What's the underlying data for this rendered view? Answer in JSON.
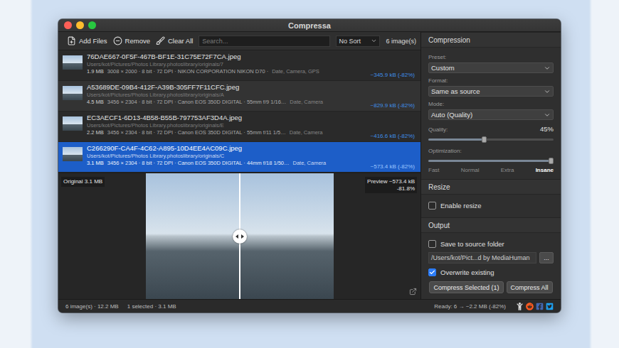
{
  "window": {
    "title": "Compressa"
  },
  "toolbar": {
    "buttons": [
      "Add Files",
      "Remove",
      "Clear All"
    ],
    "search": {
      "placeholder": "Search..."
    },
    "sort": "No Sort",
    "count": "6 image(s)"
  },
  "files": [
    {
      "name": "76DAE667-0F5F-467B-BF1E-31C75E72F7CA.jpeg",
      "path": "Users/kot/Pictures/Photos Library.photoslibrary/originals/7",
      "size": "1.9 MB",
      "meta": "3008 × 2000 · 8 bit · 72 DPI · NIKON CORPORATION NIKON D70 ·",
      "tags": "Date, Camera, GPS",
      "result": "~345.9 kB (-82%)",
      "selected": false
    },
    {
      "name": "A53689DE-09B4-412F-A39B-305FF7F11CFC.jpeg",
      "path": "Users/kot/Pictures/Photos Library.photoslibrary/originals/A",
      "size": "4.5 MB",
      "meta": "3456 × 2304 · 8 bit · 72 DPI · Canon EOS 350D DIGITAL · 55mm f/9 1/16…",
      "tags": "Date, Camera",
      "result": "~829.9 kB (-82%)",
      "selected": false
    },
    {
      "name": "EC3AECF1-6D13-4B58-B55B-797753AF3D4A.jpeg",
      "path": "Users/kot/Pictures/Photos Library.photoslibrary/originals/E",
      "size": "2.2 MB",
      "meta": "3456 × 2304 · 8 bit · 72 DPI · Canon EOS 350D DIGITAL · 55mm f/11 1/5…",
      "tags": "Date, Camera",
      "result": "~416.6 kB (-82%)",
      "selected": false
    },
    {
      "name": "C266290F-CA4F-4C62-A895-10D4EE4AC09C.jpeg",
      "path": "Users/kot/Pictures/Photos Library.photoslibrary/originals/C",
      "size": "3.1 MB",
      "meta": "3456 × 2304 · 8 bit · 72 DPI · Canon EOS 350D DIGITAL · 44mm f/18 1/50…",
      "tags": "Date, Camera",
      "result": "~573.4 kB (-82%)",
      "selected": true
    }
  ],
  "preview": {
    "original": "Original 3.1 MB",
    "preview_size": "Preview ~573.4 kB",
    "preview_ratio": "-81.8%",
    "split": 0.5
  },
  "compression": {
    "title": "Compression",
    "preset": {
      "label": "Preset:",
      "value": "Custom"
    },
    "format": {
      "label": "Format:",
      "value": "Same as source"
    },
    "mode": {
      "label": "Mode:",
      "value": "Auto (Quality)"
    },
    "quality": {
      "label": "Quality:",
      "reading": "45%",
      "level": 0.45
    },
    "optimization": {
      "label": "Optimization:",
      "level": 1,
      "stops": [
        {
          "label": "Fast",
          "selected": false
        },
        {
          "label": "Normal",
          "selected": false
        },
        {
          "label": "Extra",
          "selected": false
        },
        {
          "label": "Insane",
          "selected": true
        }
      ]
    }
  },
  "resize": {
    "title": "Resize",
    "enable": {
      "label": "Enable resize",
      "checked": false
    }
  },
  "output": {
    "title": "Output",
    "save_to_source": {
      "label": "Save to source folder",
      "checked": false
    },
    "path": "/Users/kot/Pict...d by MediaHuman",
    "browse": "...",
    "overwrite": {
      "label": "Overwrite existing",
      "checked": true
    }
  },
  "actions": [
    "Compress Selected (1)",
    "Compress All"
  ],
  "status_bar": {
    "summary": "6 image(s) · 12.2 MB",
    "selection": "1 selected · 3.1 MB",
    "ready": "Ready: 6 → ~2.2 MB (-82%)"
  }
}
